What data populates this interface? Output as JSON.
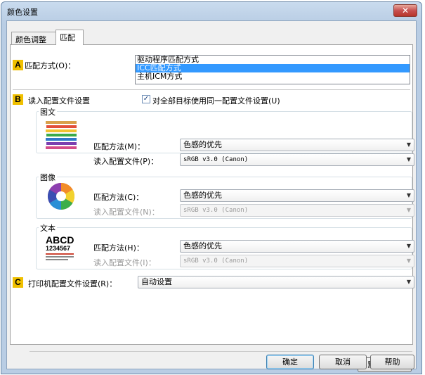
{
  "window": {
    "title": "颜色设置",
    "close_label": "✕"
  },
  "tabs": [
    {
      "label": "颜色调整"
    },
    {
      "label": "匹配"
    }
  ],
  "section_a": {
    "badge": "A",
    "label": "匹配方式(O)：",
    "options": [
      "驱动程序匹配方式",
      "ICC匹配方式",
      "主机ICM方式"
    ],
    "selected_index": 1
  },
  "section_b": {
    "badge": "B",
    "label": "读入配置文件设置",
    "same_profile_checkbox": {
      "label": "对全部目标使用同一配置文件设置(U)",
      "checked": true,
      "mark": "✓"
    },
    "graphics": {
      "title": "图文",
      "method_label": "匹配方法(M)：",
      "method_value": "色感的优先",
      "profile_label": "读入配置文件(P)：",
      "profile_value": "sRGB v3.0 (Canon)"
    },
    "image": {
      "title": "图像",
      "method_label": "匹配方法(C)：",
      "method_value": "色感的优先",
      "profile_label": "读入配置文件(N)：",
      "profile_value": "sRGB v3.0 (Canon)"
    },
    "text": {
      "title": "文本",
      "icon_big": "ABCD",
      "icon_num": "1234567",
      "method_label": "匹配方法(H)：",
      "method_value": "色感的优先",
      "profile_label": "读入配置文件(I)：",
      "profile_value": "sRGB v3.0 (Canon)"
    }
  },
  "section_c": {
    "badge": "C",
    "label": "打印机配置文件设置(R)：",
    "value": "自动设置"
  },
  "dropdown_arrow": "▼",
  "buttons": {
    "defaults": "默认值(F)",
    "ok": "确定",
    "cancel": "取消",
    "help": "帮助"
  },
  "colors": {
    "selection": "#3399ff",
    "badge": "#f0c000",
    "close": "#c75050"
  }
}
